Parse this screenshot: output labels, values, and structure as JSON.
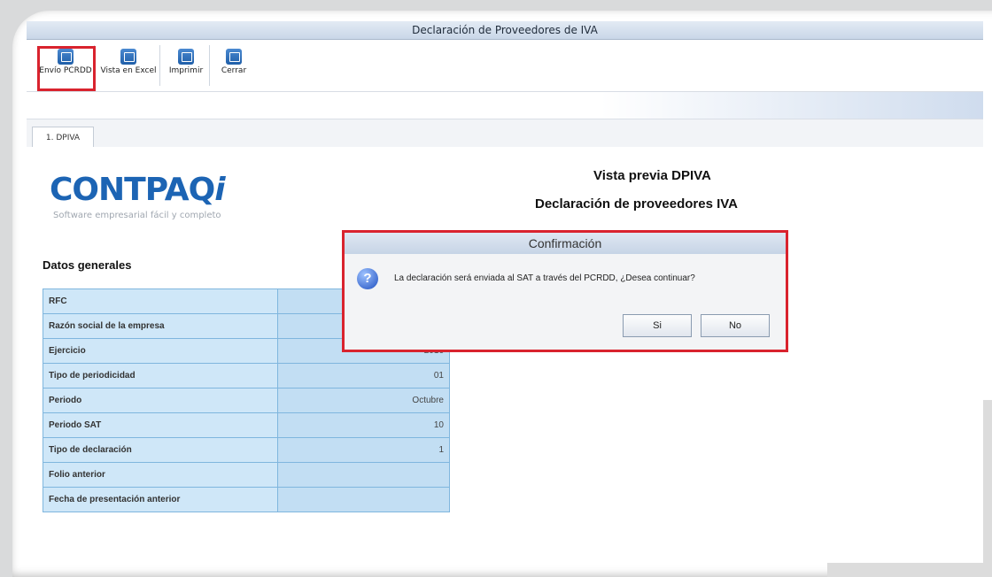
{
  "window": {
    "title": "Declaración de Proveedores de IVA"
  },
  "toolbar": {
    "items": [
      {
        "label": "Envío PCRDD"
      },
      {
        "label": "Vista en Excel"
      },
      {
        "label": "Imprimir"
      },
      {
        "label": "Cerrar"
      }
    ]
  },
  "tabs": [
    {
      "label": "1. DPIVA"
    }
  ],
  "logo": {
    "brand_main": "CONTPAQ",
    "brand_i": "i",
    "tagline": "Software empresarial fácil y completo"
  },
  "preview": {
    "title": "Vista previa DPIVA",
    "subtitle": "Declaración de proveedores IVA",
    "section": "Datos generales",
    "rows": [
      {
        "label": "RFC",
        "value": ""
      },
      {
        "label": "Razón social de la empresa",
        "value": ""
      },
      {
        "label": "Ejercicio",
        "value": "2016"
      },
      {
        "label": "Tipo de periodicidad",
        "value": "01"
      },
      {
        "label": "Periodo",
        "value": "Octubre"
      },
      {
        "label": "Periodo SAT",
        "value": "10"
      },
      {
        "label": "Tipo de declaración",
        "value": "1"
      },
      {
        "label": "Folio anterior",
        "value": ""
      },
      {
        "label": "Fecha de presentación anterior",
        "value": ""
      }
    ]
  },
  "dialog": {
    "title": "Confirmación",
    "icon": "?",
    "message": "La declaración será enviada al SAT a través del PCRDD, ¿Desea continuar?",
    "yes": "Si",
    "no": "No"
  },
  "colors": {
    "highlight": "#d9232e",
    "brand": "#1c64b4"
  }
}
